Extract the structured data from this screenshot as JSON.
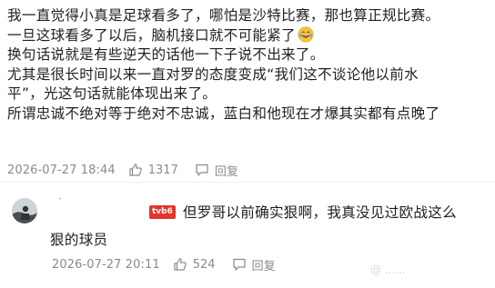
{
  "main_comment": {
    "lines": [
      "我一直觉得小真是足球看多了，哪怕是沙特比赛，那也算正规比赛。",
      "一旦这球看多了以后，脑机接口就不可能紧了",
      "换句话说就是有些逆天的话他一下子说不出来了。",
      "尤其是很长时间以来一直对罗的态度变成“我们这不谈论他以前水",
      "平”，光这句话就能体现出来了。",
      "所谓忠诚不绝对等于绝对不忠诚，蓝白和他现在才爆其实都有点晚了"
    ],
    "emoji": "laughing-crying-emoji",
    "timestamp": "2026-07-27 18:44",
    "like_count": "1317",
    "reply_label": "回复"
  },
  "reply_comment": {
    "username_masked": "·",
    "badge": "tvb6",
    "text_line1": "但罗哥以前确实狠啊，我真没见过欧战这么",
    "text_line2": "狠的球员",
    "timestamp": "2026-07-27 20:11",
    "like_count": "524",
    "reply_label": "回复"
  },
  "watermark": "@ ......",
  "colors": {
    "text": "#1f1f1f",
    "meta": "#8a8a8a",
    "badge": "#e3352c",
    "divider": "#efefef"
  }
}
